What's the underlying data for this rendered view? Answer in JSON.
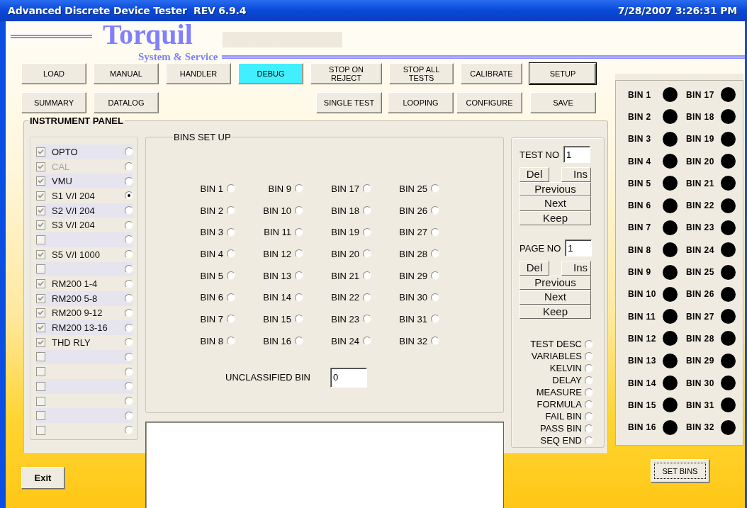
{
  "window": {
    "title": "Advanced Discrete Device Tester  REV 6.9.4",
    "clock": "7/28/2007 3:26:31 PM"
  },
  "logo": {
    "name": "Torquil",
    "tagline": "System & Service"
  },
  "toolbar": [
    {
      "left": [
        {
          "label": "LOAD",
          "active": false,
          "focused": false
        },
        {
          "label": "MANUAL",
          "active": false,
          "focused": false
        },
        {
          "label": "HANDLER",
          "active": false,
          "focused": false
        },
        {
          "label": "DEBUG",
          "active": true,
          "focused": false
        },
        {
          "label": "STOP ON REJECT",
          "active": false,
          "focused": false
        },
        {
          "label": "STOP ALL TESTS",
          "active": false,
          "focused": false
        },
        {
          "label": "CALIBRATE",
          "active": false,
          "focused": false
        },
        {
          "label": "SETUP",
          "active": false,
          "focused": true
        }
      ]
    },
    {
      "left": [
        {
          "label": "SUMMARY",
          "active": false,
          "focused": false
        },
        {
          "label": "DATALOG",
          "active": false,
          "focused": false
        }
      ],
      "right": [
        {
          "label": "SINGLE TEST",
          "active": false,
          "focused": false
        },
        {
          "label": "LOOPING",
          "active": false,
          "focused": false
        },
        {
          "label": "CONFIGURE",
          "active": false,
          "focused": false
        },
        {
          "label": "SAVE",
          "active": false,
          "focused": false
        }
      ]
    }
  ],
  "instrument_panel": {
    "title": "INSTRUMENT PANEL",
    "instruments": [
      {
        "label": "OPTO",
        "checked": true,
        "disabled": false,
        "selected": false
      },
      {
        "label": "CAL",
        "checked": true,
        "disabled": true,
        "selected": false
      },
      {
        "label": "VMU",
        "checked": true,
        "disabled": false,
        "selected": false
      },
      {
        "label": "S1 V/I 204",
        "checked": true,
        "disabled": false,
        "selected": true
      },
      {
        "label": "S2 V/I 204",
        "checked": true,
        "disabled": false,
        "selected": false
      },
      {
        "label": "S3 V/I 204",
        "checked": true,
        "disabled": false,
        "selected": false
      },
      {
        "checked": false,
        "selected": false
      },
      {
        "label": "S5 V/I 1000",
        "checked": true,
        "disabled": false,
        "selected": false
      },
      {
        "checked": false,
        "selected": false
      },
      {
        "label": "RM200 1-4",
        "checked": true,
        "disabled": false,
        "selected": false
      },
      {
        "label": "RM200 5-8",
        "checked": true,
        "disabled": false,
        "selected": false
      },
      {
        "label": "RM200 9-12",
        "checked": true,
        "disabled": false,
        "selected": false
      },
      {
        "label": "RM200 13-16",
        "checked": true,
        "disabled": false,
        "selected": false
      },
      {
        "label": "THD RLY",
        "checked": true,
        "disabled": false,
        "selected": false
      },
      {
        "checked": false,
        "selected": false
      },
      {
        "checked": false,
        "selected": false
      },
      {
        "checked": false,
        "selected": false
      },
      {
        "checked": false,
        "selected": false
      },
      {
        "checked": false,
        "selected": false
      },
      {
        "checked": false,
        "selected": false
      }
    ],
    "bins_setup": {
      "title": "BINS SET UP",
      "bins": [
        {
          "label": "BIN 1",
          "selected": false
        },
        {
          "label": "BIN 9",
          "selected": false
        },
        {
          "label": "BIN 17",
          "selected": false
        },
        {
          "label": "BIN 25",
          "selected": false
        },
        {
          "label": "BIN 2",
          "selected": false
        },
        {
          "label": "BIN 10",
          "selected": false
        },
        {
          "label": "BIN 18",
          "selected": false
        },
        {
          "label": "BIN 26",
          "selected": false
        },
        {
          "label": "BIN 3",
          "selected": false
        },
        {
          "label": "BIN 11",
          "selected": false
        },
        {
          "label": "BIN 19",
          "selected": false
        },
        {
          "label": "BIN 27",
          "selected": false
        },
        {
          "label": "BIN 4",
          "selected": false
        },
        {
          "label": "BIN 12",
          "selected": false
        },
        {
          "label": "BIN 20",
          "selected": false
        },
        {
          "label": "BIN 28",
          "selected": false
        },
        {
          "label": "BIN 5",
          "selected": false
        },
        {
          "label": "BIN 13",
          "selected": false
        },
        {
          "label": "BIN 21",
          "selected": false
        },
        {
          "label": "BIN 29",
          "selected": false
        },
        {
          "label": "BIN 6",
          "selected": false
        },
        {
          "label": "BIN 14",
          "selected": false
        },
        {
          "label": "BIN 22",
          "selected": false
        },
        {
          "label": "BIN 30",
          "selected": false
        },
        {
          "label": "BIN 7",
          "selected": false
        },
        {
          "label": "BIN 15",
          "selected": false
        },
        {
          "label": "BIN 23",
          "selected": false
        },
        {
          "label": "BIN 31",
          "selected": false
        },
        {
          "label": "BIN 8",
          "selected": false
        },
        {
          "label": "BIN 16",
          "selected": false
        },
        {
          "label": "BIN 24",
          "selected": false
        },
        {
          "label": "BIN 32",
          "selected": false
        }
      ],
      "unclassified": {
        "label": "UNCLASSIFIED BIN",
        "value": "0"
      }
    },
    "navigators": [
      {
        "label": "TEST NO",
        "value": "1",
        "buttons": [
          "Del",
          "Ins",
          "Previous",
          "Next",
          "Keep"
        ]
      },
      {
        "label": "PAGE NO",
        "value": "1",
        "buttons": [
          "Del",
          "Ins",
          "Previous",
          "Next",
          "Keep"
        ]
      }
    ],
    "options": [
      {
        "label": "TEST DESC",
        "selected": false
      },
      {
        "label": "VARIABLES",
        "selected": false
      },
      {
        "label": "KELVIN",
        "selected": false
      },
      {
        "label": "DELAY",
        "selected": false
      },
      {
        "label": "MEASURE",
        "selected": false
      },
      {
        "label": "FORMULA",
        "selected": false
      },
      {
        "label": "FAIL BIN",
        "selected": false
      },
      {
        "label": "PASS BIN",
        "selected": false
      },
      {
        "label": "SEQ END",
        "selected": false
      }
    ]
  },
  "bin_indicators": [
    {
      "label": "BIN 1",
      "on": false
    },
    {
      "label": "BIN 17",
      "on": false
    },
    {
      "label": "BIN 2",
      "on": false
    },
    {
      "label": "BIN 18",
      "on": false
    },
    {
      "label": "BIN 3",
      "on": false
    },
    {
      "label": "BIN 19",
      "on": false
    },
    {
      "label": "BIN 4",
      "on": false
    },
    {
      "label": "BIN 20",
      "on": false
    },
    {
      "label": "BIN 5",
      "on": false
    },
    {
      "label": "BIN 21",
      "on": false
    },
    {
      "label": "BIN 6",
      "on": false
    },
    {
      "label": "BIN 22",
      "on": false
    },
    {
      "label": "BIN 7",
      "on": false
    },
    {
      "label": "BIN 23",
      "on": false
    },
    {
      "label": "BIN 8",
      "on": false
    },
    {
      "label": "BIN 24",
      "on": false
    },
    {
      "label": "BIN 9",
      "on": false
    },
    {
      "label": "BIN 25",
      "on": false
    },
    {
      "label": "BIN 10",
      "on": false
    },
    {
      "label": "BIN 26",
      "on": false
    },
    {
      "label": "BIN 11",
      "on": false
    },
    {
      "label": "BIN 27",
      "on": false
    },
    {
      "label": "BIN 12",
      "on": false
    },
    {
      "label": "BIN 28",
      "on": false
    },
    {
      "label": "BIN 13",
      "on": false
    },
    {
      "label": "BIN 29",
      "on": false
    },
    {
      "label": "BIN 14",
      "on": false
    },
    {
      "label": "BIN 30",
      "on": false
    },
    {
      "label": "BIN 15",
      "on": false
    },
    {
      "label": "BIN 31",
      "on": false
    },
    {
      "label": "BIN 16",
      "on": false
    },
    {
      "label": "BIN 32",
      "on": false
    }
  ],
  "exit_button": "Exit",
  "set_bins_button": "SET BINS"
}
